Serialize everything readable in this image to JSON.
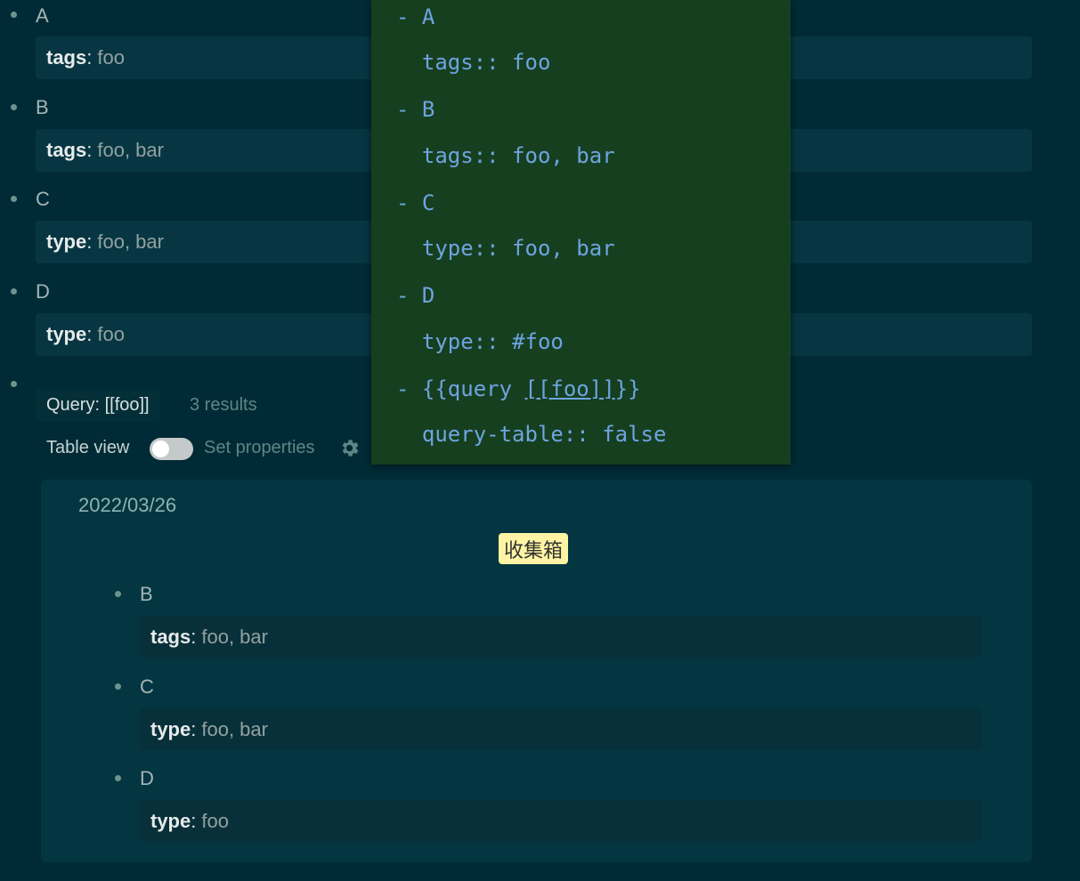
{
  "blocks": [
    {
      "title": "A",
      "prop_key": "tags",
      "prop_value": "foo"
    },
    {
      "title": "B",
      "prop_key": "tags",
      "prop_value": "foo, bar"
    },
    {
      "title": "C",
      "prop_key": "type",
      "prop_value": "foo, bar"
    },
    {
      "title": "D",
      "prop_key": "type",
      "prop_value": "foo"
    }
  ],
  "query": {
    "title": "Query: [[foo]]",
    "count": "3 results",
    "table_view_label": "Table view",
    "table_view_on": false,
    "set_properties_label": "Set properties",
    "result_page": {
      "date": "2022/03/26",
      "tag": "收集箱",
      "blocks": [
        {
          "title": "B",
          "prop_key": "tags",
          "prop_value": "foo, bar"
        },
        {
          "title": "C",
          "prop_key": "type",
          "prop_value": "foo, bar"
        },
        {
          "title": "D",
          "prop_key": "type",
          "prop_value": "foo"
        }
      ]
    }
  },
  "source_popup": {
    "lines": [
      "- A",
      "  tags:: foo",
      "- B",
      "  tags:: foo, bar",
      "- C",
      "  type:: foo, bar",
      "- D",
      "  type:: #foo",
      "- {{query ",
      "  query-table:: false"
    ],
    "query_link": "[[foo]]",
    "query_close": "}}"
  },
  "colors": {
    "background": "#002b36",
    "property_bg": "#073642",
    "popup_bg": "#163f1f",
    "popup_text": "#6ea4e0",
    "tag_bg": "#fff4a3"
  }
}
